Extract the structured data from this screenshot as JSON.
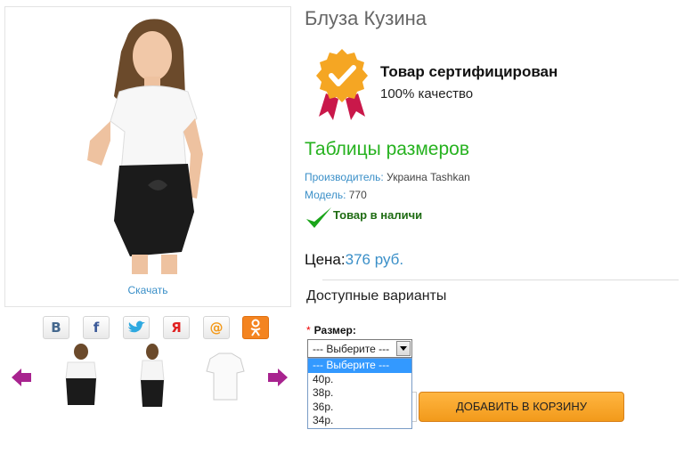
{
  "product": {
    "title": "Блуза Кузина",
    "download_label": "Скачать"
  },
  "social": [
    {
      "icon": "vk-icon",
      "glyph": "В",
      "color": "#45688e"
    },
    {
      "icon": "facebook-icon",
      "glyph": "f",
      "color": "#3b5998"
    },
    {
      "icon": "twitter-icon",
      "glyph": "🐦",
      "color": "#2fa9e0"
    },
    {
      "icon": "yandex-icon",
      "glyph": "Я",
      "color": "#e02020"
    },
    {
      "icon": "mailru-icon",
      "glyph": "@",
      "color": "#f49a1a"
    },
    {
      "icon": "odnoklassniki-icon",
      "glyph": "ок",
      "color": "#f48420"
    }
  ],
  "certificate": {
    "title": "Товар сертифицирован",
    "subtitle": "100% качество"
  },
  "size_tables_link": "Таблицы размеров",
  "manufacturer": {
    "label": "Производитель:",
    "value": "Украина Tashkan"
  },
  "model": {
    "label": "Модель:",
    "value": "770"
  },
  "stock": "Товар в наличи",
  "price": {
    "label": "Цена:",
    "value": "376 руб."
  },
  "variants_heading": "Доступные варианты",
  "size": {
    "label": "Размер:",
    "required_mark": "*",
    "selected": "--- Выберите ---",
    "options": [
      "--- Выберите ---",
      "40р.",
      "38р.",
      "36р.",
      "34р."
    ]
  },
  "cart_button": "ДОБАВИТЬ В КОРЗИНУ",
  "colors": {
    "accent_blue": "#3a8fc8",
    "green": "#26b21f",
    "orange": "#f29a1b"
  }
}
